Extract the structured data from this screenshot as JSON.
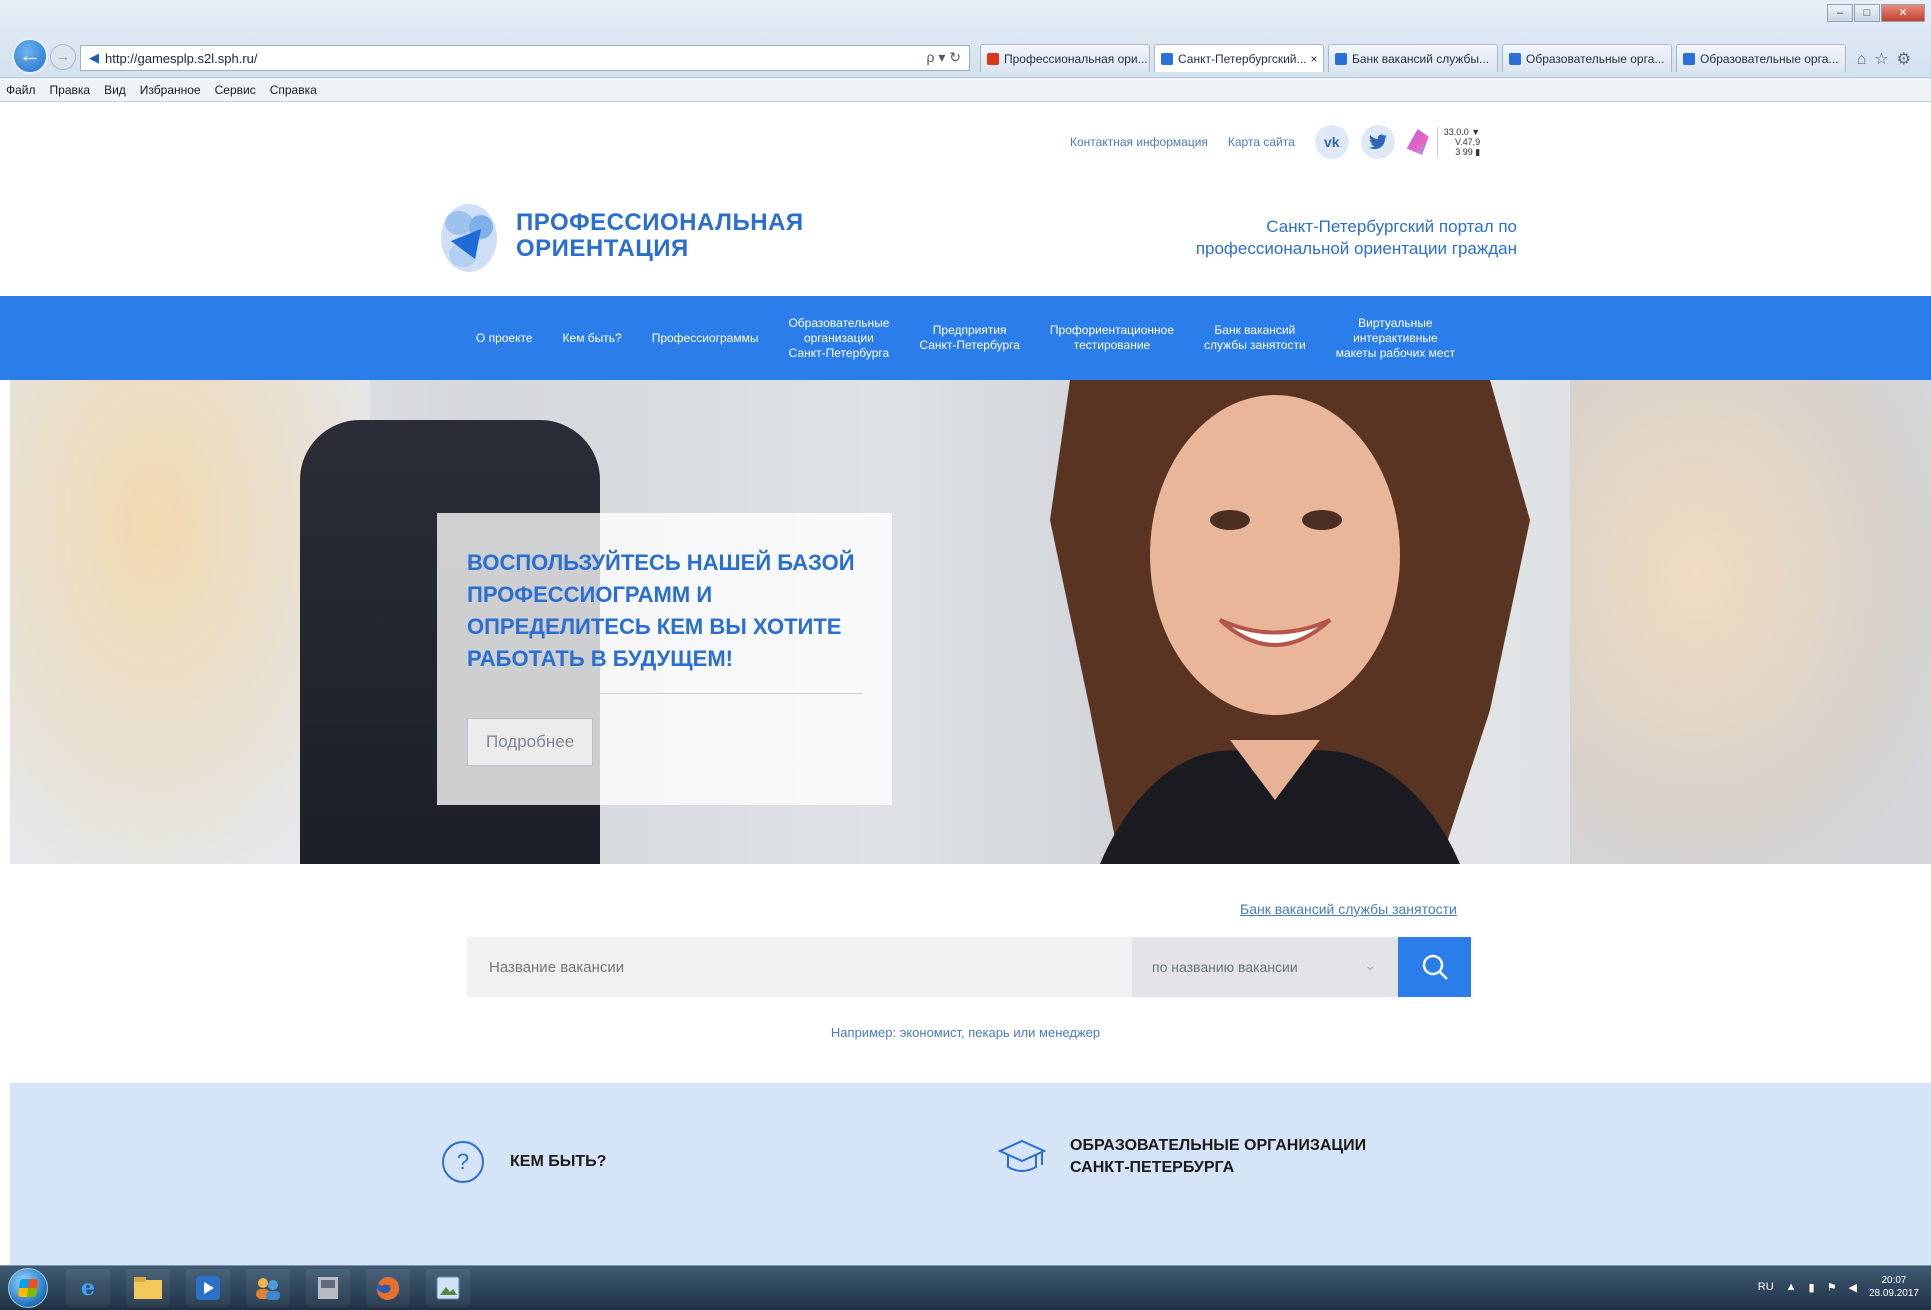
{
  "browser": {
    "address": "http://gamesplp.s2l.sph.ru/",
    "address_tools": "ρ ▾ ↻",
    "tabs": [
      {
        "label": "Профессиональная ори...",
        "color": "#d9361c",
        "active": false
      },
      {
        "label": "Санкт-Петербургский...",
        "color": "#2b6fd8",
        "active": true,
        "close": "×"
      },
      {
        "label": "Банк вакансий службы...",
        "color": "#2b6fd8",
        "active": false
      },
      {
        "label": "Образовательные орга...",
        "color": "#2b6fd8",
        "active": false
      },
      {
        "label": "Образовательные орга...",
        "color": "#2b6fd8",
        "active": false
      }
    ],
    "menu": [
      "Файл",
      "Правка",
      "Вид",
      "Избранное",
      "Сервис",
      "Справка"
    ]
  },
  "header": {
    "top_links": [
      "Контактная информация",
      "Карта сайта"
    ],
    "social": {
      "vk": "vk"
    },
    "weather": [
      "33.0.0 ▼",
      "V.47.9",
      "3 99 ▮"
    ],
    "logo_line1": "ПРОФЕССИОНАЛЬНАЯ",
    "logo_line2": "ОРИЕНТАЦИЯ",
    "tagline_line1": "Санкт-Петербургский портал по",
    "tagline_line2": "профессиональной ориентации граждан"
  },
  "nav": [
    {
      "l1": "О проекте"
    },
    {
      "l1": "Кем быть?"
    },
    {
      "l1": "Профессиограммы"
    },
    {
      "l1": "Образовательные",
      "l2": "организации",
      "l3": "Санкт-Петербурга"
    },
    {
      "l1": "Предприятия",
      "l2": "Санкт-Петербурга"
    },
    {
      "l1": "Профориентационное",
      "l2": "тестирование"
    },
    {
      "l1": "Банк вакансий",
      "l2": "службы занятости"
    },
    {
      "l1": "Виртуальные",
      "l2": "интерактивные",
      "l3": "макеты рабочих мест"
    }
  ],
  "promo": {
    "line1": "ВОСПОЛЬЗУЙТЕСЬ НАШЕЙ БАЗОЙ",
    "line2": "ПРОФЕССИОГРАММ И",
    "line3": "ОПРЕДЕЛИТЕСЬ КЕМ ВЫ ХОТИТЕ",
    "line4": "РАБОТАТЬ В БУДУЩЕМ!",
    "button": "Подробнее"
  },
  "search": {
    "bank_link": "Банк вакансий службы занятости",
    "placeholder": "Название вакансии",
    "mode": "по названию вакансии",
    "example": "Например: экономист, пекарь или менеджер"
  },
  "features": [
    {
      "title": "КЕМ БЫТЬ?"
    },
    {
      "title_l1": "ОБРАЗОВАТЕЛЬНЫЕ ОРГАНИЗАЦИИ",
      "title_l2": "САНКТ-ПЕТЕРБУРГА"
    }
  ],
  "taskbar": {
    "tray": [
      "RU",
      "▲",
      "▮",
      "⚑",
      "◀"
    ],
    "time": "20:07",
    "date": "28.09.2017"
  }
}
